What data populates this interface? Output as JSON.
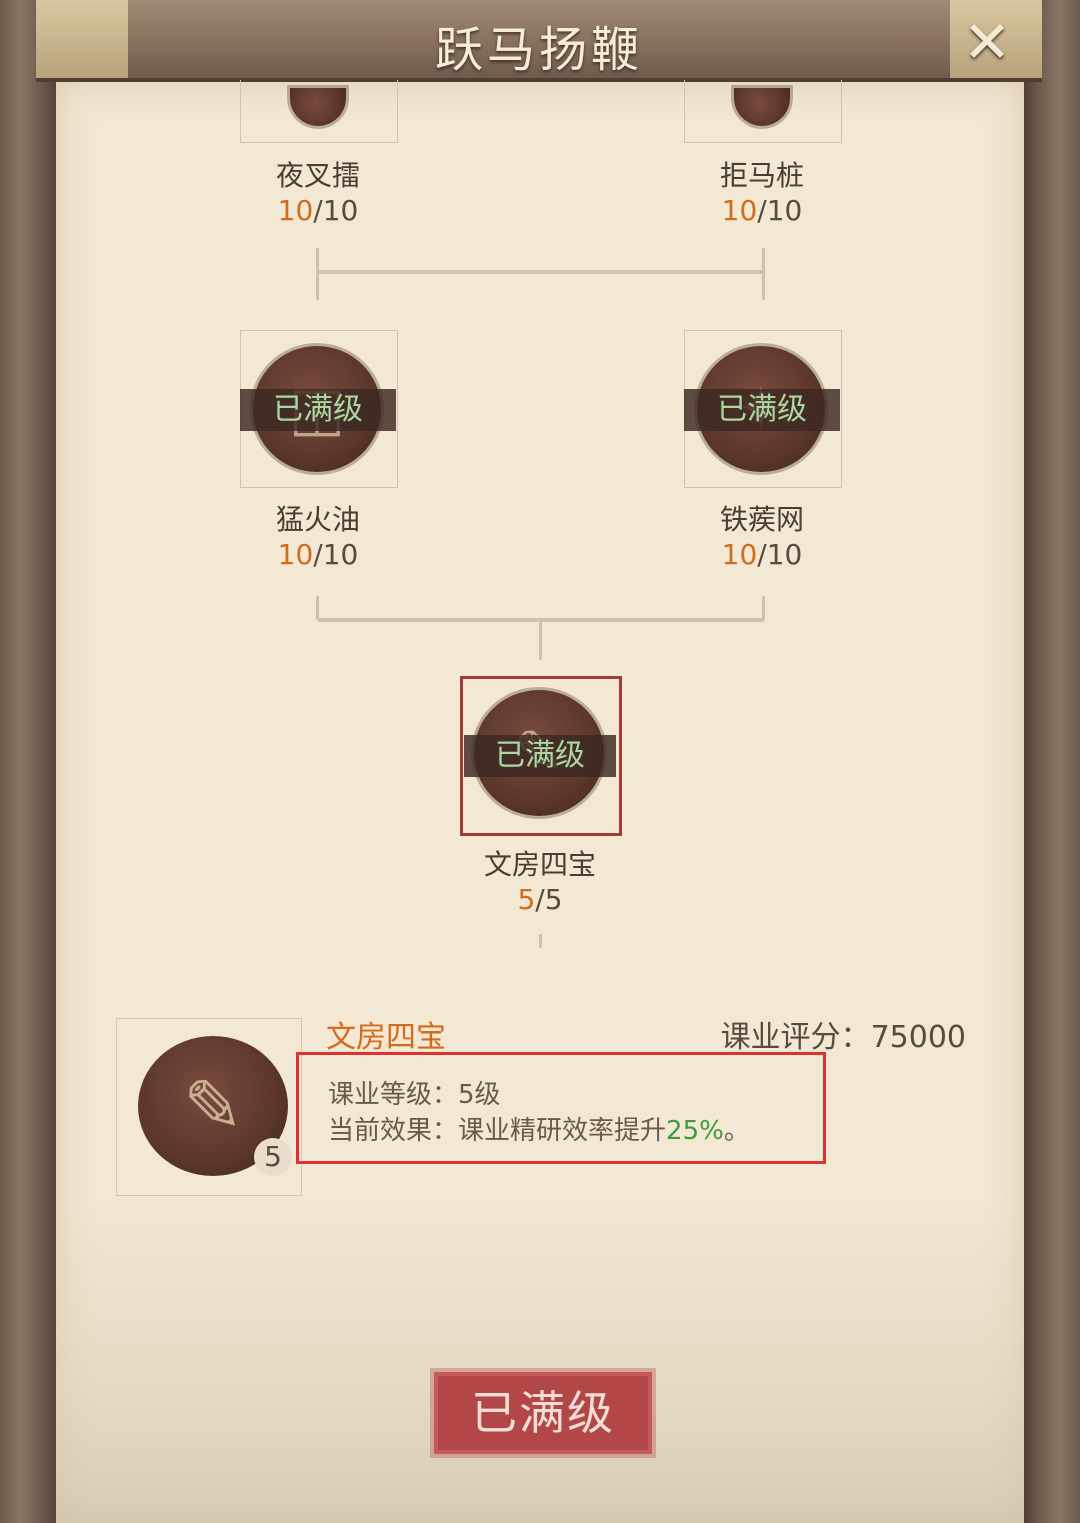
{
  "header": {
    "title": "跃马扬鞭",
    "close_icon": "close-icon"
  },
  "tree": {
    "row1": [
      {
        "name": "夜叉擂",
        "current": "10",
        "max": "/10"
      },
      {
        "name": "拒马桩",
        "current": "10",
        "max": "/10"
      }
    ],
    "row2": [
      {
        "name": "猛火油",
        "current": "10",
        "max": "/10",
        "badge": "已满级",
        "icon": "bucket-icon"
      },
      {
        "name": "铁蒺网",
        "current": "10",
        "max": "/10",
        "badge": "已满级",
        "icon": "caltrop-icon"
      }
    ],
    "row3": [
      {
        "name": "文房四宝",
        "current": "5",
        "max": "/5",
        "badge": "已满级",
        "icon": "scroll-brush-icon"
      }
    ]
  },
  "detail": {
    "name": "文房四宝",
    "score_label": "课业评分：",
    "score_value": "75000",
    "level_label": "课业等级：",
    "level_value": "5级",
    "effect_label": "当前效果：",
    "effect_text": "课业精研效率提升",
    "effect_value": "25%",
    "effect_suffix": "。",
    "badge_level": "5",
    "icon": "scroll-brush-icon"
  },
  "action": {
    "button_label": "已满级"
  },
  "colors": {
    "accent_orange": "#d06c1e",
    "maxed_green": "#a9d8a0",
    "highlight_red": "#e03131",
    "stamp_red": "#b34748"
  }
}
